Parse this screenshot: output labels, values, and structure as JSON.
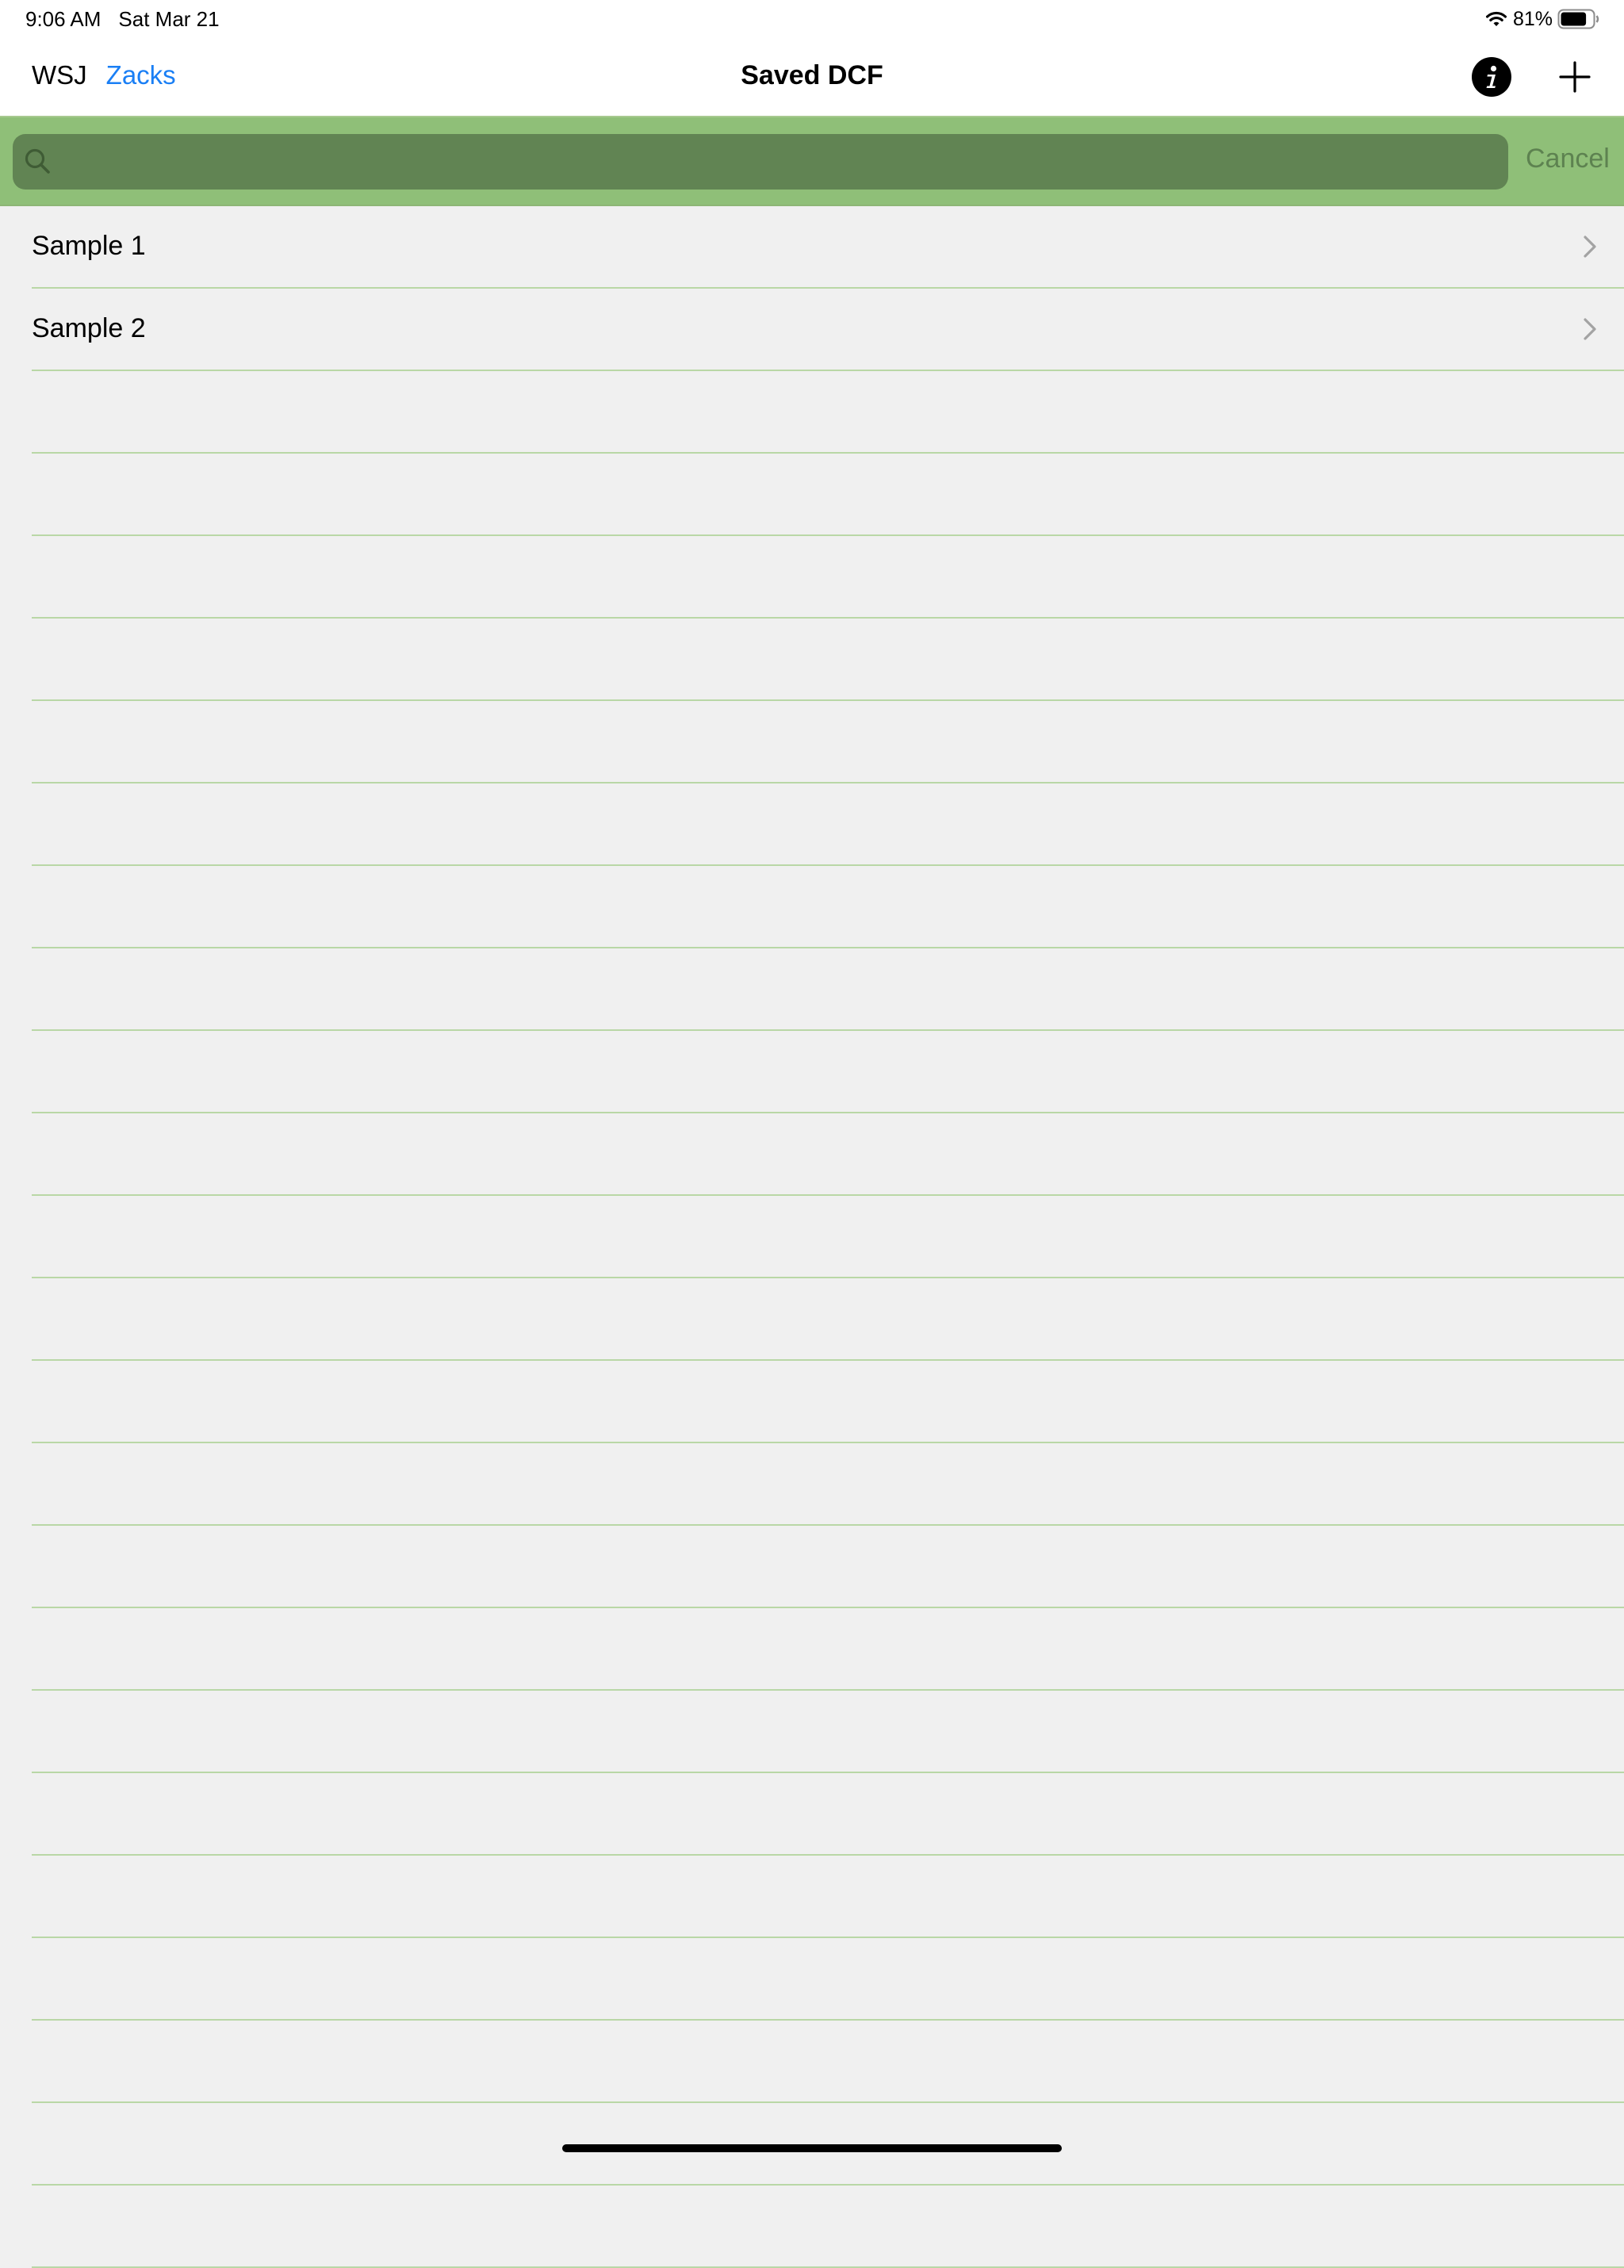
{
  "status_bar": {
    "time": "9:06 AM",
    "date": "Sat Mar 21",
    "battery_percent": "81%",
    "battery_level": 0.81,
    "icons": [
      "wifi-icon",
      "battery-icon"
    ]
  },
  "nav": {
    "left_links": [
      "WSJ",
      "Zacks"
    ],
    "title": "Saved DCF",
    "right_icons": [
      "info-icon",
      "plus-icon"
    ]
  },
  "search": {
    "placeholder": "",
    "value": "",
    "cancel_label": "Cancel"
  },
  "list": {
    "items": [
      {
        "label": "Sample 1"
      },
      {
        "label": "Sample 2"
      }
    ]
  },
  "colors": {
    "accent_link": "#1a7ff5",
    "search_band": "#8fbf78",
    "search_field": "#618453",
    "separator": "#b9d7a6",
    "background": "#f0f0f0"
  }
}
